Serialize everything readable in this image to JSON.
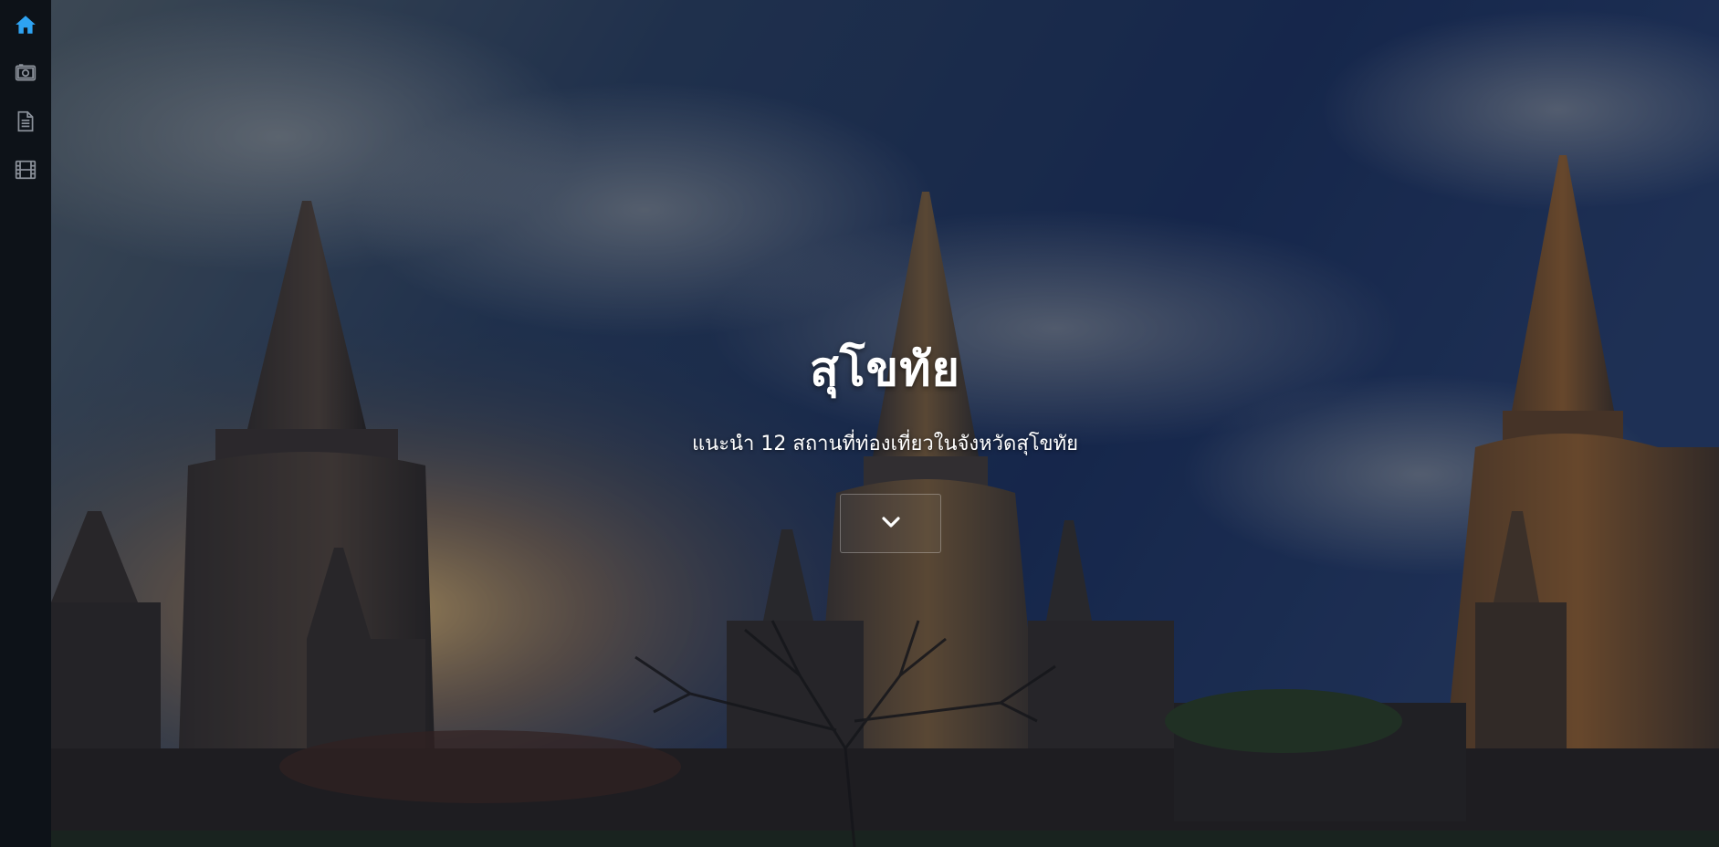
{
  "sidebar": {
    "items": [
      {
        "name": "home",
        "icon": "home-icon",
        "active": true
      },
      {
        "name": "gallery",
        "icon": "photo-icon",
        "active": false
      },
      {
        "name": "article",
        "icon": "document-icon",
        "active": false
      },
      {
        "name": "video",
        "icon": "film-icon",
        "active": false
      }
    ],
    "active_color": "#2ea3f2",
    "inactive_color": "#8a9099"
  },
  "hero": {
    "title": "สุโขทัย",
    "subtitle": "แนะนำ 12 สถานที่ท่องเที่ยวในจังหวัดสุโขทัย",
    "scroll_icon": "chevron-down-icon"
  }
}
